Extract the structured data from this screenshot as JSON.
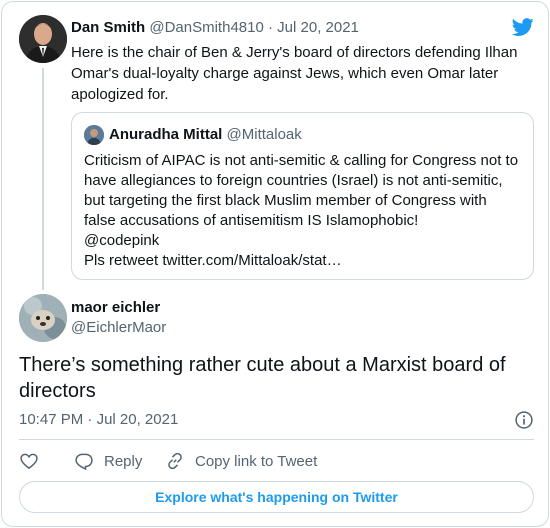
{
  "colors": {
    "accent": "#1d9bf0",
    "text": "#0f1419",
    "muted": "#536471",
    "border": "#cfd9de"
  },
  "icons": {
    "brand": "twitter-bird-icon",
    "like": "heart-icon",
    "reply": "speech-bubble-icon",
    "copy": "link-icon",
    "info": "info-icon"
  },
  "parent_tweet": {
    "author_name": "Dan Smith",
    "author_handle": "@DanSmith4810",
    "separator": "·",
    "date": "Jul 20, 2021",
    "text": "Here is the chair of Ben & Jerry's board of directors defending Ilhan Omar's dual-loyalty charge against Jews, which even Omar later apologized for."
  },
  "quoted_tweet": {
    "author_name": "Anuradha Mittal",
    "author_handle": "@Mittaloak",
    "lines": [
      "Criticism of AIPAC is not anti-semitic & calling for Congress not to",
      "have allegiances to foreign countries (Israel) is not anti-semitic,",
      "but targeting the first black Muslim member of Congress with",
      "false accusations of antisemitism IS Islamophobic!",
      "@codepink",
      "Pls retweet twitter.com/Mittaloak/stat…"
    ]
  },
  "reply_tweet": {
    "author_name": "maor eichler",
    "author_handle": "@EichlerMaor",
    "text": "There’s something rather cute about a Marxist board of directors",
    "time": "10:47 PM",
    "separator": "·",
    "date": "Jul 20, 2021"
  },
  "actions": {
    "reply_label": "Reply",
    "copy_label": "Copy link to Tweet"
  },
  "footer": {
    "explore_label": "Explore what's happening on Twitter"
  }
}
